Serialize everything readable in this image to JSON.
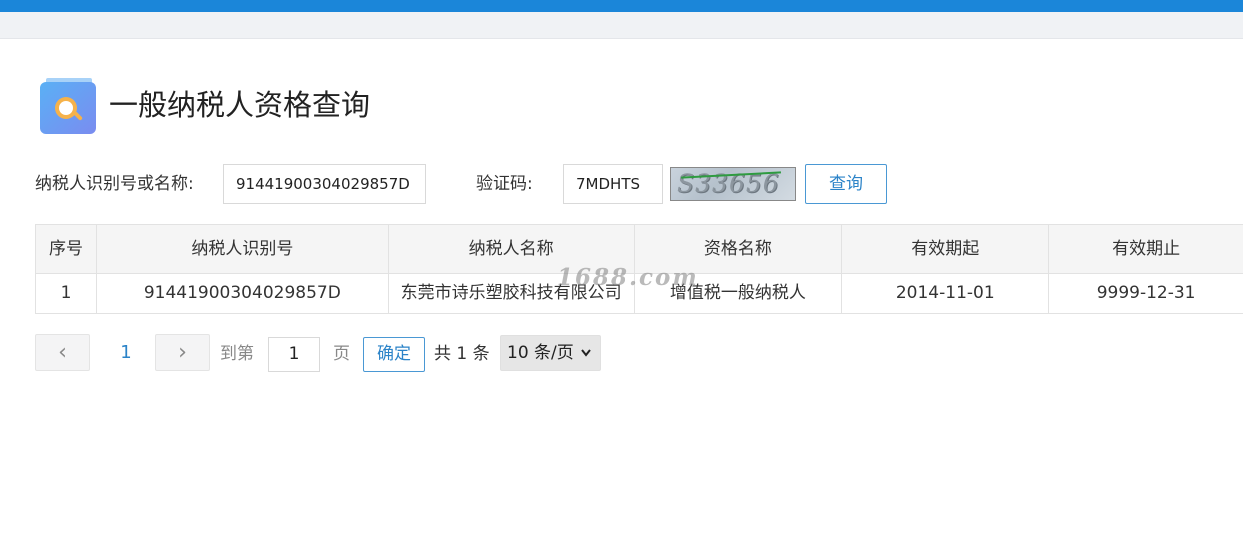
{
  "header": {
    "title": "一般纳税人资格查询"
  },
  "form": {
    "taxpayer_label": "纳税人识别号或名称:",
    "taxpayer_value": "91441900304029857D",
    "captcha_label": "验证码:",
    "captcha_value": "7MDHTS",
    "captcha_image_text": "S33656",
    "query_button": "查询"
  },
  "table": {
    "headers": [
      "序号",
      "纳税人识别号",
      "纳税人名称",
      "资格名称",
      "有效期起",
      "有效期止"
    ],
    "rows": [
      [
        "1",
        "91441900304029857D",
        "东莞市诗乐塑胶科技有限公司",
        "增值税一般纳税人",
        "2014-11-01",
        "9999-12-31"
      ]
    ]
  },
  "watermark": "1688.com",
  "pagination": {
    "prev_icon": "‹",
    "next_icon": "›",
    "current_page": "1",
    "goto_label": "到第",
    "goto_value": "1",
    "page_label": "页",
    "confirm_button": "确定",
    "total_text": "共 1 条",
    "page_size": "10 条/页",
    "page_size_icon": "chevron-down-icon"
  },
  "colors": {
    "top_bar": "#1b86d9",
    "accent": "#2b83c8"
  }
}
